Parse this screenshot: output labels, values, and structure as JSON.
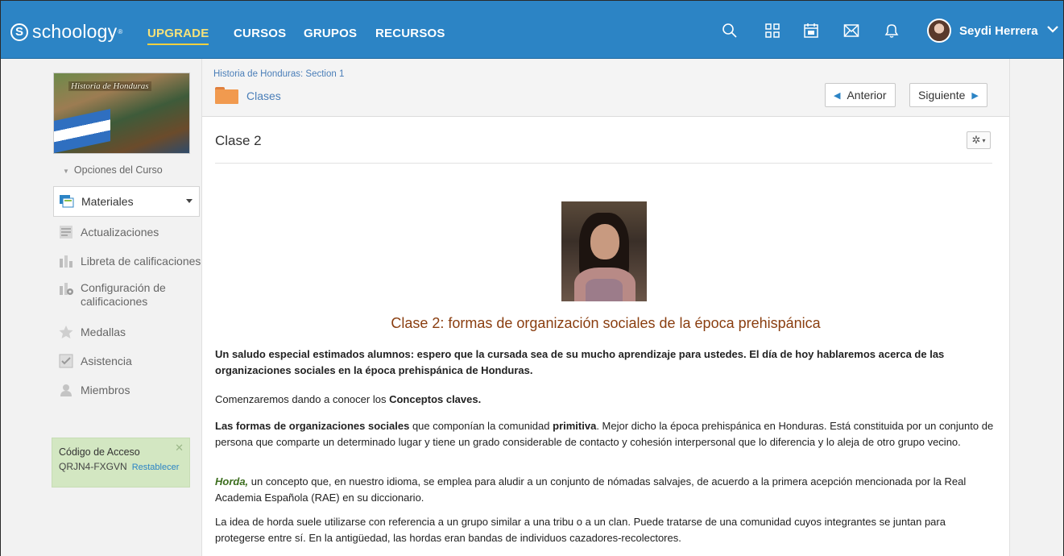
{
  "topbar": {
    "logo": "schoology",
    "nav": [
      "UPGRADE",
      "CURSOS",
      "GRUPOS",
      "RECURSOS"
    ],
    "icons": [
      "search-icon",
      "apps-grid-icon",
      "calendar-icon",
      "mail-icon",
      "bell-icon"
    ],
    "user_name": "Seydi Herrera"
  },
  "sidebar": {
    "course_image_title": "Historia de Honduras",
    "options_label": "Opciones del Curso",
    "items": [
      {
        "label": "Materiales",
        "icon": "materials-icon",
        "active": true
      },
      {
        "label": "Actualizaciones",
        "icon": "updates-icon"
      },
      {
        "label": "Libreta de calificaciones",
        "icon": "gradebook-icon"
      },
      {
        "label": "Configuración de calificaciones",
        "icon": "grade-settings-icon"
      },
      {
        "label": "Medallas",
        "icon": "badge-icon"
      },
      {
        "label": "Asistencia",
        "icon": "attendance-icon"
      },
      {
        "label": "Miembros",
        "icon": "members-icon"
      }
    ],
    "access": {
      "heading": "Código de Acceso",
      "code": "QRJN4-FXGVN",
      "reset": "Restablecer"
    }
  },
  "main": {
    "breadcrumb": "Historia de Honduras: Section 1",
    "folder": "Clases",
    "prev_label": "Anterior",
    "next_label": "Siguiente",
    "title": "Clase 2",
    "content_title": "Clase 2: formas de organización sociales de la época prehispánica",
    "p1": "Un saludo especial estimados alumnos: espero que la cursada sea de su mucho aprendizaje para ustedes. El día de hoy hablaremos acerca de las organizaciones sociales en la época prehispánica de Honduras.",
    "p2_a": "Comenzaremos dando a conocer los ",
    "p2_b": "Conceptos claves.",
    "p3_a": "Las formas de organizaciones sociales",
    "p3_b": " que componían la comunidad ",
    "p3_c": "primitiva",
    "p3_d": ". Mejor dicho la época prehispánica en Honduras. Está constituida por un conjunto de persona que comparte un determinado lugar y tiene un grado considerable de contacto y cohesión interpersonal que lo diferencia y lo aleja de otro grupo vecino.",
    "p4_a": "Horda,",
    "p4_b": " un concepto que, en nuestro idioma, se emplea para aludir a un conjunto de nómadas salvajes, de acuerdo a la primera acepción mencionada por la Real Academia Española (RAE) en su diccionario.",
    "p5": "La idea de horda suele utilizarse con referencia a un grupo similar a una tribu o a un clan. Puede tratarse de una comunidad cuyos integrantes se juntan para protegerse entre sí. En la antigüedad, las hordas eran bandas de individuos cazadores-recolectores."
  },
  "colors": {
    "topbar": "#2c84c5",
    "title_brown": "#8a3e10",
    "horda_green": "#3c6e1e",
    "access_bg": "#d3e7c2"
  }
}
